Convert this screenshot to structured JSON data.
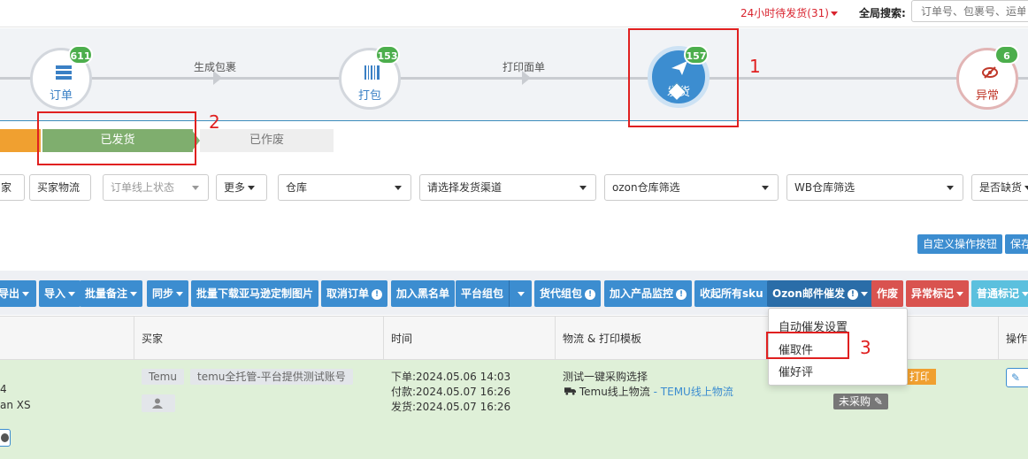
{
  "topbar": {
    "pending_label": "24小时待发货(31)",
    "global_search_label": "全局搜索:",
    "global_search_placeholder": "订单号、包裹号、运单"
  },
  "workflow": {
    "nodes": [
      {
        "label": "订单",
        "count": "611"
      },
      {
        "label": "打包",
        "count": "153"
      },
      {
        "label": "发货",
        "count": "157"
      },
      {
        "label": "异常",
        "count": "6"
      }
    ],
    "edges": [
      "生成包裹",
      "打印面单"
    ]
  },
  "status_steps": {
    "shipped": "已发货",
    "voided": "已作废"
  },
  "filters": {
    "seller_btn": "家",
    "buyer_logistics_btn": "买家物流",
    "online_status_placeholder": "订单线上状态",
    "more_btn": "更多",
    "warehouse_select": "仓库",
    "channel_select": "请选择发货渠道",
    "ozon_warehouse_select": "ozon仓库筛选",
    "wb_warehouse_select": "WB仓库筛选",
    "stockout_select": "是否缺货"
  },
  "actions": {
    "custom_buttons": "自定义操作按钮",
    "save": "保存"
  },
  "toolbar": {
    "export": "导出",
    "import": "导入",
    "batch_note": "批量备注",
    "sync": "同步",
    "batch_download_amazon": "批量下载亚马逊定制图片",
    "cancel_order": "取消订单",
    "add_blacklist": "加入黑名单",
    "platform_package": "平台组包",
    "agent_package": "货代组包",
    "add_product_monitor": "加入产品监控",
    "collect_all_sku": "收起所有sku",
    "ozon_mail_urge": "Ozon邮件催发",
    "void": "作废",
    "abnormal_mark": "异常标记",
    "normal_mark": "普通标记"
  },
  "ozon_dropdown": {
    "items": [
      "自动催发设置",
      "催取件",
      "催好评"
    ]
  },
  "table": {
    "headers": {
      "buyer": "买家",
      "time": "时间",
      "logistics": "物流 & 打印模板",
      "ops": "操作"
    },
    "row": {
      "product_fragment_1": "4",
      "product_fragment_2": "an XS",
      "buyer_platform": "Temu",
      "buyer_name": "temu全托管-平台提供测试账号",
      "order_time": "下单:2024.05.06 14:03",
      "pay_time": "付款:2024.05.07 16:26",
      "ship_time": "发货:2024.05.07 16:26",
      "logistics_template": "测试一键采购选择",
      "logistics_carrier": "Temu线上物流",
      "logistics_separator": " - ",
      "logistics_link": "TEMU线上物流",
      "print_badge": "打印",
      "purchase_status": "未采购"
    }
  },
  "annotations": [
    "1",
    "2",
    "3"
  ],
  "colors": {
    "primary": "#3c8dd0",
    "danger": "#d9534f",
    "success": "#4cae4c",
    "annotation_red": "#e02020"
  }
}
